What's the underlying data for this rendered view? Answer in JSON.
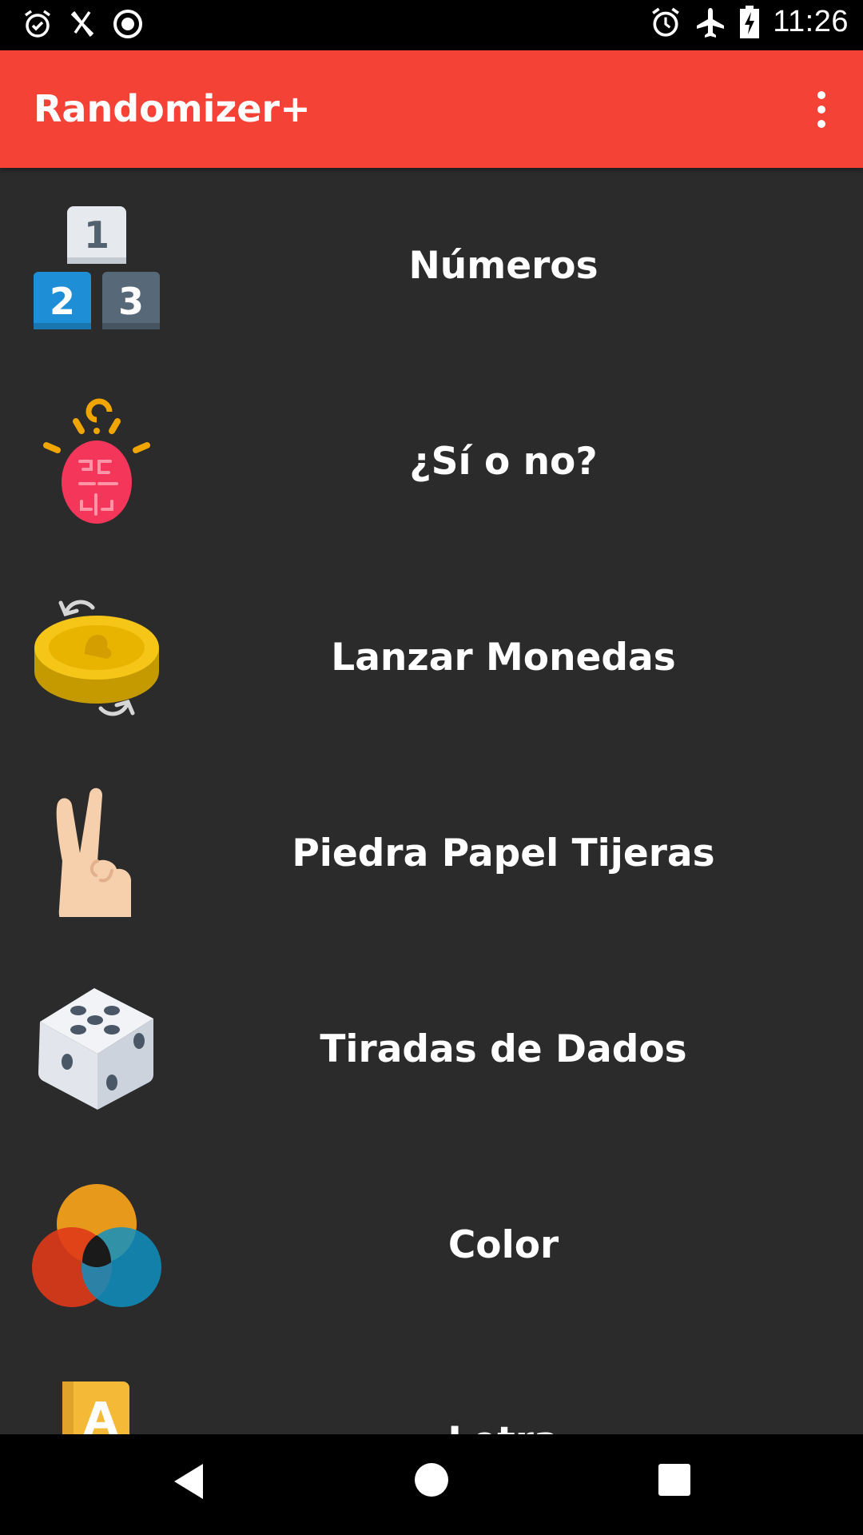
{
  "status_bar": {
    "left_icons": [
      "alarm-clock-icon",
      "utensils-off-icon",
      "record-icon"
    ],
    "right_icons": [
      "alarm-clock-icon",
      "airplane-mode-icon",
      "battery-charging-icon"
    ],
    "time": "11:26"
  },
  "app_bar": {
    "title": "Randomizer+",
    "overflow_icon": "more-vert-icon",
    "color": "#f44336"
  },
  "menu": {
    "items": [
      {
        "label": "Números",
        "icon": "numbers-123-icon"
      },
      {
        "label": "¿Sí o no?",
        "icon": "brain-idea-icon"
      },
      {
        "label": "Lanzar Monedas",
        "icon": "coin-flip-icon"
      },
      {
        "label": "Piedra Papel Tijeras",
        "icon": "victory-hand-icon"
      },
      {
        "label": "Tiradas de Dados",
        "icon": "dice-icon"
      },
      {
        "label": "Color",
        "icon": "color-circles-icon"
      },
      {
        "label": "Letra",
        "icon": "letter-a-icon"
      }
    ]
  },
  "nav_bar": {
    "icons": [
      "back-icon",
      "home-icon",
      "recents-icon"
    ]
  }
}
